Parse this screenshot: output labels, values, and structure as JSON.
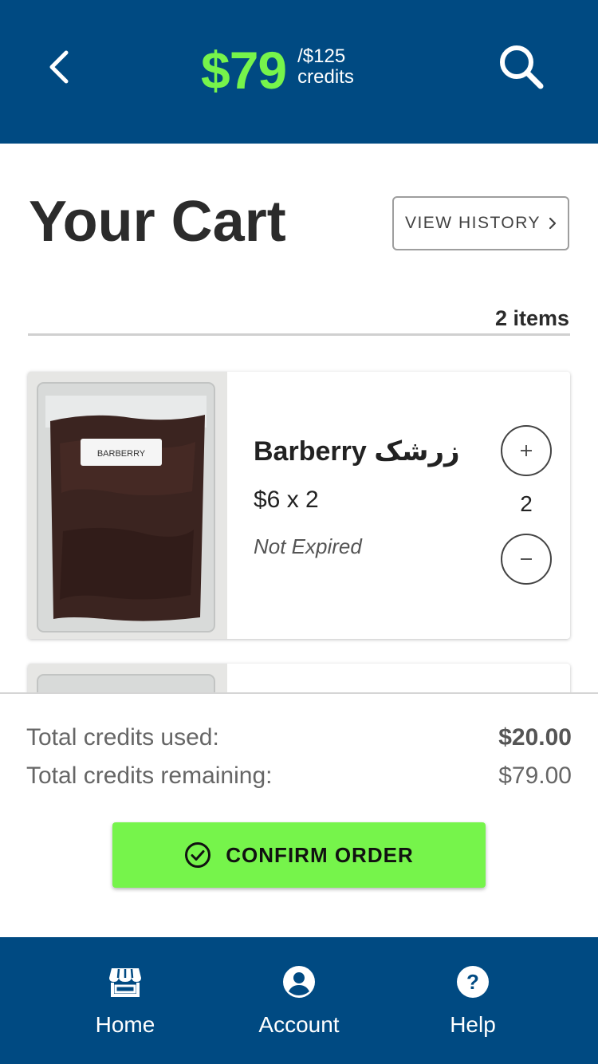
{
  "header": {
    "credits_amount": "$79",
    "credits_total": "/$125",
    "credits_unit": "credits"
  },
  "page": {
    "title": "Your Cart",
    "view_history_label": "VIEW HISTORY",
    "item_count": "2 items"
  },
  "cart_items": [
    {
      "name": "Barberry زرشک",
      "package_label": "BARBERRY",
      "price_line": "$6 x 2",
      "status": "Not Expired",
      "quantity": "2"
    }
  ],
  "summary": {
    "used_label": "Total credits used:",
    "used_value": "$20.00",
    "remaining_label": "Total credits remaining:",
    "remaining_value": "$79.00",
    "confirm_label": "CONFIRM ORDER"
  },
  "bottom_nav": [
    {
      "label": "Home",
      "icon": "store-icon"
    },
    {
      "label": "Account",
      "icon": "account-circle-icon"
    },
    {
      "label": "Help",
      "icon": "help-circle-icon"
    }
  ],
  "colors": {
    "primary": "#004a82",
    "accent": "#76f44b"
  }
}
